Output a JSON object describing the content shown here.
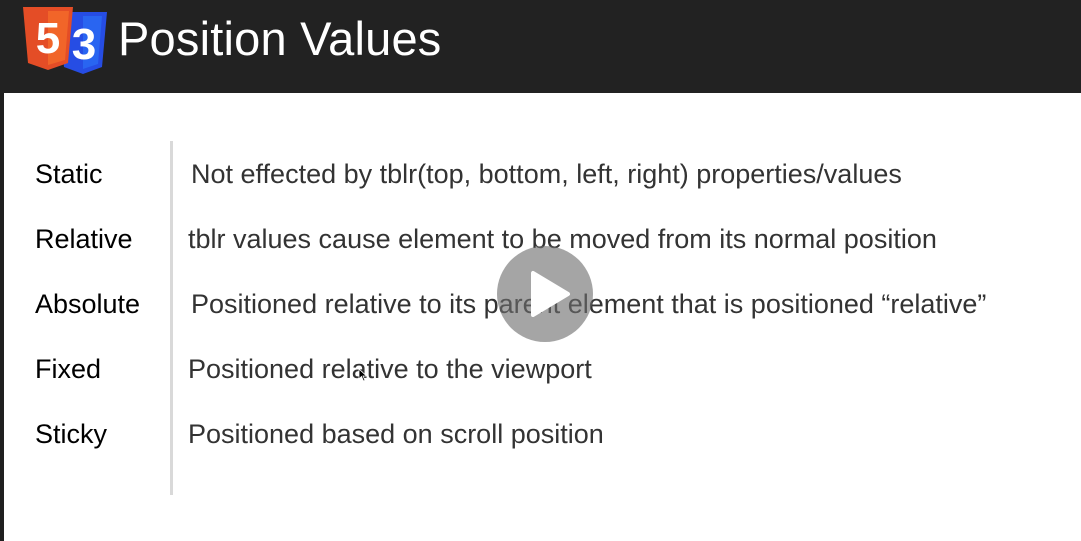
{
  "header": {
    "title": "Position Values",
    "logo_icons": [
      "html5-icon",
      "css3-icon"
    ],
    "html5_glyph": "5",
    "css3_glyph": "3",
    "background_color": "#222222"
  },
  "rows": [
    {
      "term": "Static",
      "description": "Not effected by tblr(top, bottom, left, right) properties/values"
    },
    {
      "term": "Relative",
      "description": "tblr values cause element to be moved from its normal position"
    },
    {
      "term": "Absolute",
      "description": "Positioned relative to its parent element that is positioned “relative”"
    },
    {
      "term": "Fixed",
      "description": "Positioned relative to the viewport"
    },
    {
      "term": "Sticky",
      "description": "Positioned based on scroll position"
    }
  ],
  "video": {
    "play_icon": "play-icon",
    "overlay_color": "rgba(110,110,110,0.62)"
  },
  "colors": {
    "html5": "#e44d26",
    "css3": "#264de4",
    "divider": "#d9d9d9"
  }
}
